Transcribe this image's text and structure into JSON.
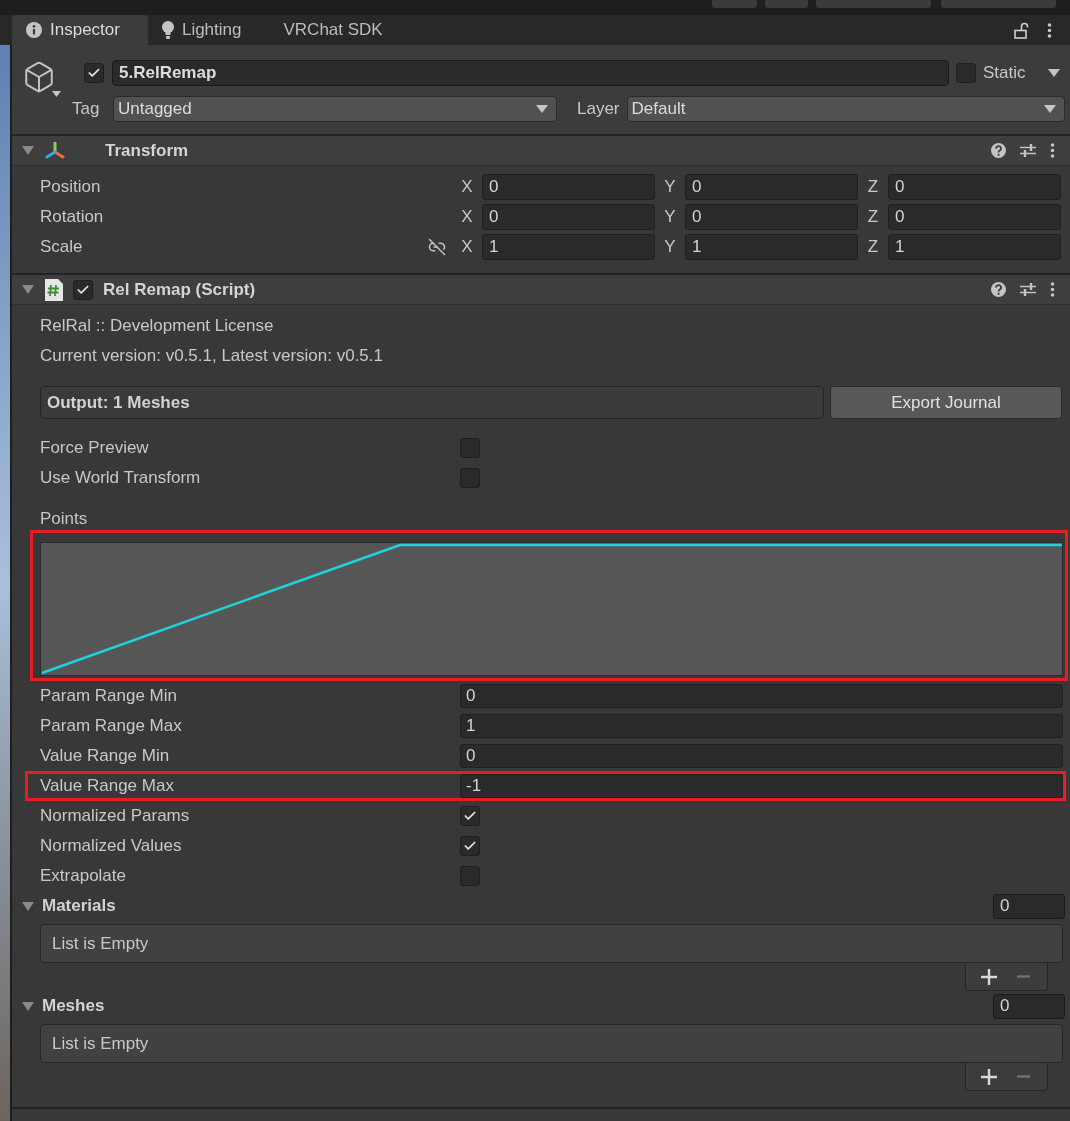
{
  "tabs": [
    {
      "label": "Inspector",
      "selected": true
    },
    {
      "label": "Lighting",
      "selected": false
    },
    {
      "label": "VRChat SDK",
      "selected": false
    }
  ],
  "inspector": {
    "locked": false
  },
  "object": {
    "active": true,
    "name": "5.RelRemap",
    "static": false,
    "static_label": "Static",
    "tag_label": "Tag",
    "tag": "Untagged",
    "layer_label": "Layer",
    "layer": "Default"
  },
  "components": [
    {
      "kind": "transform",
      "title": "Transform",
      "expanded": true,
      "rows": [
        {
          "label": "Position",
          "fields": [
            {
              "axis": "X",
              "value": "0"
            },
            {
              "axis": "Y",
              "value": "0"
            },
            {
              "axis": "Z",
              "value": "0"
            }
          ]
        },
        {
          "label": "Rotation",
          "fields": [
            {
              "axis": "X",
              "value": "0"
            },
            {
              "axis": "Y",
              "value": "0"
            },
            {
              "axis": "Z",
              "value": "0"
            }
          ]
        },
        {
          "label": "Scale",
          "constrained": false,
          "fields": [
            {
              "axis": "X",
              "value": "1"
            },
            {
              "axis": "Y",
              "value": "1"
            },
            {
              "axis": "Z",
              "value": "1"
            }
          ]
        }
      ]
    },
    {
      "kind": "script",
      "title": "Rel Remap (Script)",
      "enabled": true,
      "expanded": true,
      "notes": [
        "RelRal :: Development License",
        "Current version: v0.5.1, Latest version: v0.5.1"
      ],
      "output": "Output: 1 Meshes",
      "action": "Export Journal",
      "properties": [
        {
          "kind": "checkbox",
          "label": "Force Preview",
          "checked": false,
          "highlighted": false
        },
        {
          "kind": "checkbox",
          "label": "Use World Transform",
          "checked": false,
          "highlighted": false
        },
        {
          "kind": "curve",
          "label": "Points",
          "highlighted": true
        },
        {
          "kind": "number",
          "label": "Param Range Min",
          "value": "0",
          "highlighted": false
        },
        {
          "kind": "number",
          "label": "Param Range Max",
          "value": "1",
          "highlighted": false
        },
        {
          "kind": "number",
          "label": "Value Range Min",
          "value": "0",
          "highlighted": false
        },
        {
          "kind": "number",
          "label": "Value Range Max",
          "value": "-1",
          "highlighted": true
        },
        {
          "kind": "checkbox",
          "label": "Normalized Params",
          "checked": true,
          "highlighted": false
        },
        {
          "kind": "checkbox",
          "label": "Normalized Values",
          "checked": true,
          "highlighted": false
        },
        {
          "kind": "checkbox",
          "label": "Extrapolate",
          "checked": false,
          "highlighted": false
        },
        {
          "kind": "list",
          "label": "Materials",
          "expanded": true,
          "count": "0",
          "empty_text": "List is Empty",
          "remove_enabled": false,
          "highlighted": false
        },
        {
          "kind": "list",
          "label": "Meshes",
          "expanded": true,
          "count": "0",
          "empty_text": "List is Empty",
          "remove_enabled": false,
          "highlighted": false
        }
      ]
    }
  ]
}
